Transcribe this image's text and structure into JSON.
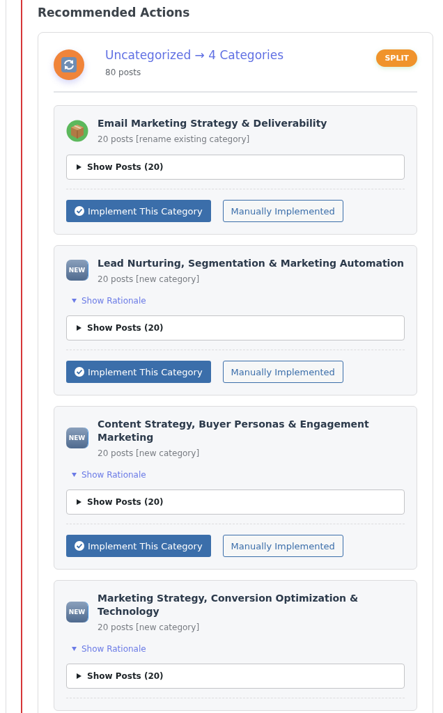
{
  "heading": "Recommended Actions",
  "action": {
    "title": "Uncategorized → 4 Categories",
    "subtitle": "80 posts",
    "badge": "SPLIT",
    "categories": [
      {
        "kind": "existing",
        "name": "Email Marketing Strategy & Deliverability",
        "meta": "20 posts [rename existing category]",
        "posts_toggle": "Show Posts (20)",
        "buttons": {
          "implement": "Implement This Category",
          "manual": "Manually Implemented"
        }
      },
      {
        "kind": "new",
        "icon_text": "NEW",
        "name": "Lead Nurturing, Segmentation & Marketing Automation",
        "meta": "20 posts [new category]",
        "rationale": "Show Rationale",
        "posts_toggle": "Show Posts (20)",
        "buttons": {
          "implement": "Implement This Category",
          "manual": "Manually Implemented"
        }
      },
      {
        "kind": "new",
        "icon_text": "NEW",
        "name": "Content Strategy, Buyer Personas & Engagement Marketing",
        "meta": "20 posts [new category]",
        "rationale": "Show Rationale",
        "posts_toggle": "Show Posts (20)",
        "buttons": {
          "implement": "Implement This Category",
          "manual": "Manually Implemented"
        }
      },
      {
        "kind": "new",
        "icon_text": "NEW",
        "name": "Marketing Strategy, Conversion Optimization & Technology",
        "meta": "20 posts [new category]",
        "rationale": "Show Rationale",
        "posts_toggle": "Show Posts (20)"
      }
    ]
  }
}
